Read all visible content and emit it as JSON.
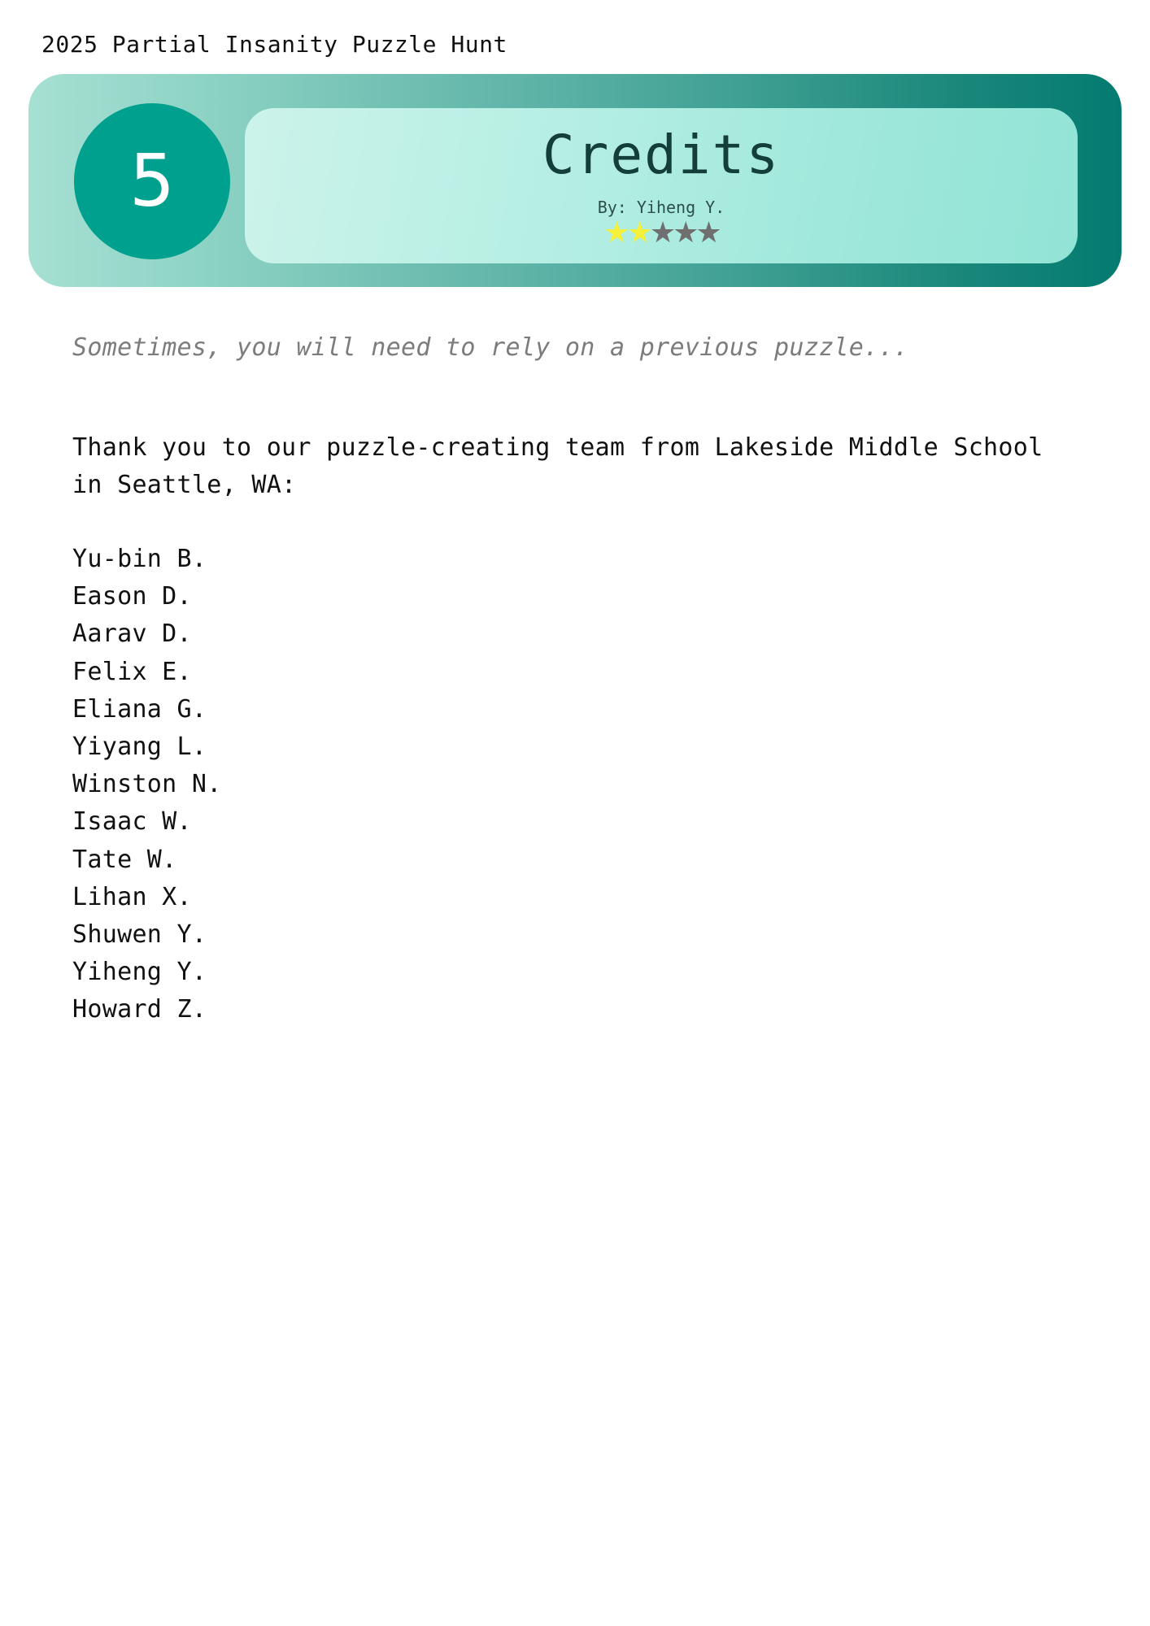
{
  "header": {
    "hunt_title": "2025 Partial Insanity Puzzle Hunt"
  },
  "banner": {
    "puzzle_number": "5",
    "puzzle_title": "Credits",
    "author": "By: Yiheng Y.",
    "difficulty": {
      "filled": 2,
      "total": 5,
      "star_glyph": "★",
      "filled_color": "#f4f03c",
      "empty_color": "#6f6f6f"
    },
    "colors": {
      "circle": "#00a08f",
      "banner_dark": "#037b70",
      "banner_light": "#a6e0d3"
    }
  },
  "content": {
    "flavor_text": "Sometimes, you will need to rely on a previous puzzle...",
    "intro": "Thank you to our puzzle-creating team from Lakeside Middle School in Seattle, WA:",
    "names": [
      "Yu-bin B.",
      "Eason D.",
      "Aarav D.",
      "Felix E.",
      "Eliana G.",
      "Yiyang L.",
      "Winston N.",
      "Isaac W.",
      "Tate W.",
      "Lihan X.",
      "Shuwen Y.",
      "Yiheng Y.",
      "Howard Z."
    ]
  }
}
